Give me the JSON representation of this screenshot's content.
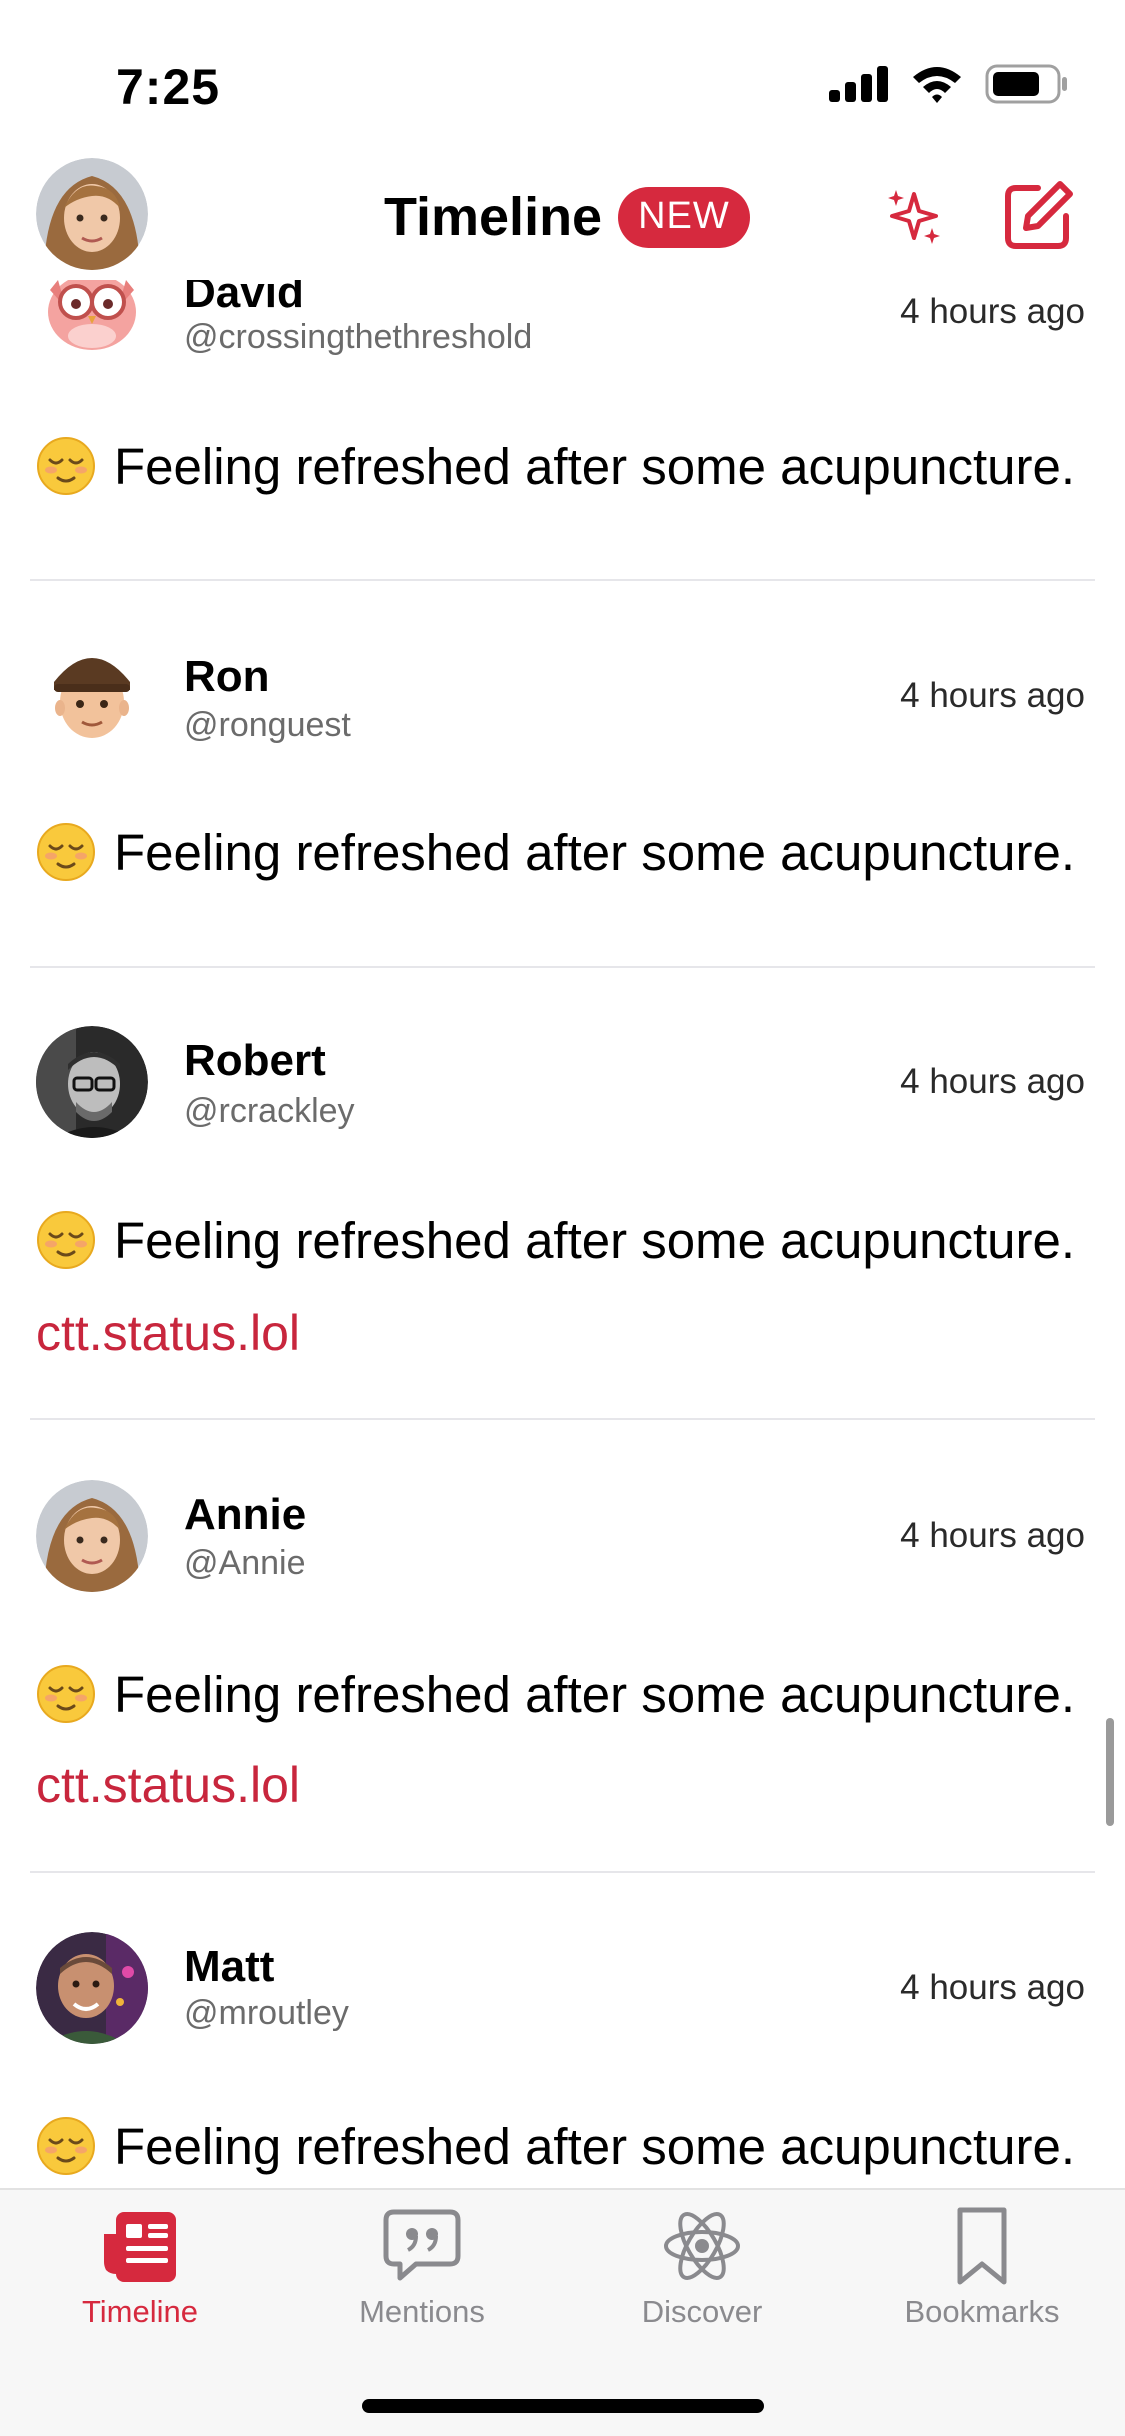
{
  "status_bar": {
    "time": "7:25"
  },
  "header": {
    "title": "Timeline",
    "badge": "NEW"
  },
  "posts": [
    {
      "name": "David",
      "handle": "@crossingthethreshold",
      "time": "4 hours ago",
      "text": "Feeling refreshed after some acupuncture.",
      "emoji": "relieved-face",
      "link": ""
    },
    {
      "name": "Ron",
      "handle": "@ronguest",
      "time": "4 hours ago",
      "text": "Feeling refreshed after some acupuncture.",
      "emoji": "relieved-face",
      "link": ""
    },
    {
      "name": "Robert",
      "handle": "@rcrackley",
      "time": "4 hours ago",
      "text": "Feeling refreshed after some acupuncture.",
      "emoji": "relieved-face",
      "link": "ctt.status.lol"
    },
    {
      "name": "Annie",
      "handle": "@Annie",
      "time": "4 hours ago",
      "text": "Feeling refreshed after some acupuncture.",
      "emoji": "relieved-face",
      "link": "ctt.status.lol"
    },
    {
      "name": "Matt",
      "handle": "@mroutley",
      "time": "4 hours ago",
      "text": "Feeling refreshed after some acupuncture.",
      "emoji": "relieved-face",
      "link": ""
    }
  ],
  "tabs": [
    {
      "label": "Timeline",
      "icon": "newspaper-icon",
      "active": true
    },
    {
      "label": "Mentions",
      "icon": "speech-bubble-quote-icon",
      "active": false
    },
    {
      "label": "Discover",
      "icon": "atom-icon",
      "active": false
    },
    {
      "label": "Bookmarks",
      "icon": "bookmark-icon",
      "active": false
    }
  ],
  "colors": {
    "accent": "#d6293e",
    "link": "#c8263d",
    "tab_inactive": "#8a8a8e"
  }
}
